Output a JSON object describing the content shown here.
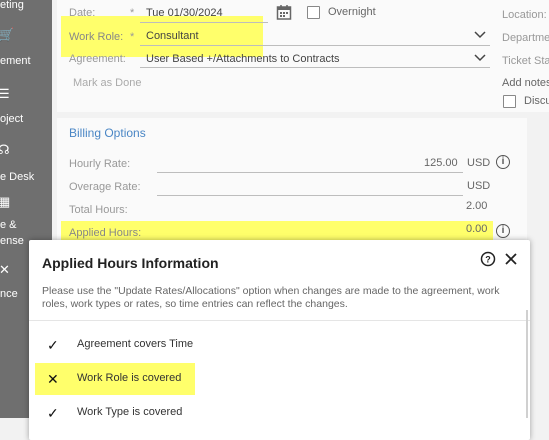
{
  "sidebar": {
    "items": [
      {
        "icon": "meeting-icon",
        "glyph": "",
        "label": "eting"
      },
      {
        "icon": "cart-icon",
        "glyph": "🛒",
        "label": "ement"
      },
      {
        "icon": "project-icon",
        "glyph": "☰",
        "label": "oject"
      },
      {
        "icon": "headset-icon",
        "glyph": "☊",
        "label": "e Desk"
      },
      {
        "icon": "calculator-icon",
        "glyph": "▦",
        "label": "e &"
      },
      {
        "icon": "",
        "glyph": "",
        "label": "ense"
      },
      {
        "icon": "finance-icon",
        "glyph": "✕",
        "label": "nce"
      }
    ]
  },
  "form": {
    "date_label": "Date:",
    "date_value": "Tue 01/30/2024",
    "overnight_label": "Overnight",
    "work_role_label": "Work Role:",
    "work_role_value": "Consultant",
    "agreement_label": "Agreement:",
    "agreement_value": "User Based +/Attachments to Contracts",
    "mark_as_done": "Mark as Done",
    "required_mark": "*"
  },
  "right_panel": {
    "location_label": "Location:",
    "department_label": "Departme",
    "ticket_status_label": "Ticket Sta",
    "add_notes_label": "Add notes",
    "discussion_label": "Discu"
  },
  "billing": {
    "title": "Billing Options",
    "hourly_rate_label": "Hourly Rate:",
    "hourly_rate_value": "125.00",
    "hourly_rate_currency": "USD",
    "overage_rate_label": "Overage Rate:",
    "overage_rate_currency": "USD",
    "total_hours_label": "Total Hours:",
    "total_hours_value": "2.00",
    "applied_hours_label": "Applied Hours:",
    "applied_hours_value": "0.00"
  },
  "modal": {
    "title": "Applied Hours Information",
    "message": "Please use the \"Update Rates/Allocations\" option when changes are made to the agreement, work roles, work types or rates, so time entries can reflect the changes.",
    "items": [
      {
        "label": "Agreement covers Time",
        "mark": "✓"
      },
      {
        "label": "Work Role is covered",
        "mark": "✕"
      },
      {
        "label": "Work Type is covered",
        "mark": "✓"
      }
    ]
  },
  "colors": {
    "highlight": "#ffff6b",
    "link": "#4a86c5",
    "sidebar": "#6f6f6f"
  }
}
